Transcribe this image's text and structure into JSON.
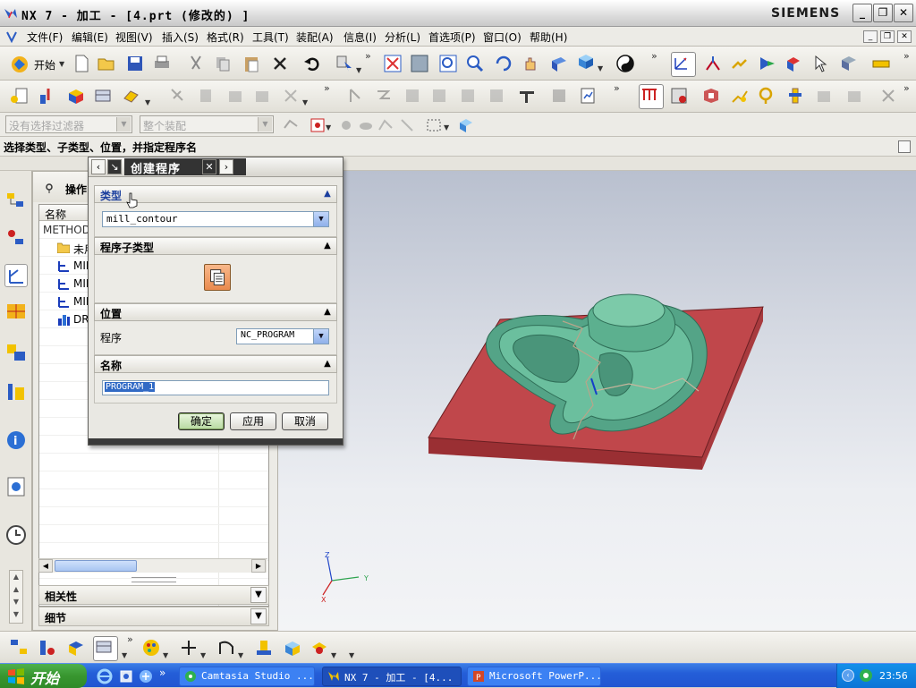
{
  "window": {
    "title": "NX 7 - 加工 - [4.prt (修改的) ]",
    "brand": "SIEMENS",
    "buttons": {
      "minimize": "_",
      "restore": "❐",
      "close": "✕"
    }
  },
  "menu": {
    "items": [
      "文件(F)",
      "编辑(E)",
      "视图(V)",
      "插入(S)",
      "格式(R)",
      "工具(T)",
      "装配(A)",
      "信息(I)",
      "分析(L)",
      "首选项(P)",
      "窗口(O)",
      "帮助(H)"
    ]
  },
  "toolbar": {
    "start_label": "开始",
    "filter_placeholder": "没有选择过滤器",
    "assembly_placeholder": "整个装配"
  },
  "cue": {
    "text": "选择类型、子类型、位置，并指定程序名"
  },
  "navigator": {
    "title": "操作",
    "column_name": "名称",
    "rows": [
      {
        "label": "METHOD",
        "indent": 0
      },
      {
        "label": "未用",
        "indent": 1
      },
      {
        "label": "MIL",
        "indent": 1
      },
      {
        "label": "MIL",
        "indent": 1
      },
      {
        "label": "MIL",
        "indent": 1
      },
      {
        "label": "DR",
        "indent": 1
      }
    ],
    "sections": [
      {
        "label": "相关性"
      },
      {
        "label": "细节"
      }
    ]
  },
  "dialog": {
    "title": "创建程序",
    "sections": {
      "type": "类型",
      "subtype": "程序子类型",
      "location": "位置",
      "name": "名称"
    },
    "type_value": "mill_contour",
    "program_label": "程序",
    "program_value": "NC_PROGRAM",
    "name_value": "PROGRAM_1",
    "buttons": {
      "ok": "确定",
      "apply": "应用",
      "cancel": "取消"
    }
  },
  "axes": {
    "z": "Z",
    "y": "Y",
    "x": "X"
  },
  "taskbar": {
    "start": "开始",
    "tasks": [
      {
        "label": "Camtasia Studio ...",
        "active": false
      },
      {
        "label": "NX 7 - 加工 - [4...",
        "active": true
      },
      {
        "label": "Microsoft PowerP...",
        "active": false
      }
    ],
    "clock": "23:56"
  },
  "colors": {
    "part_base": "#c0474b",
    "part_top": "#64b596",
    "xp_taskbar": "#245ed8",
    "xp_start": "#38962f"
  }
}
